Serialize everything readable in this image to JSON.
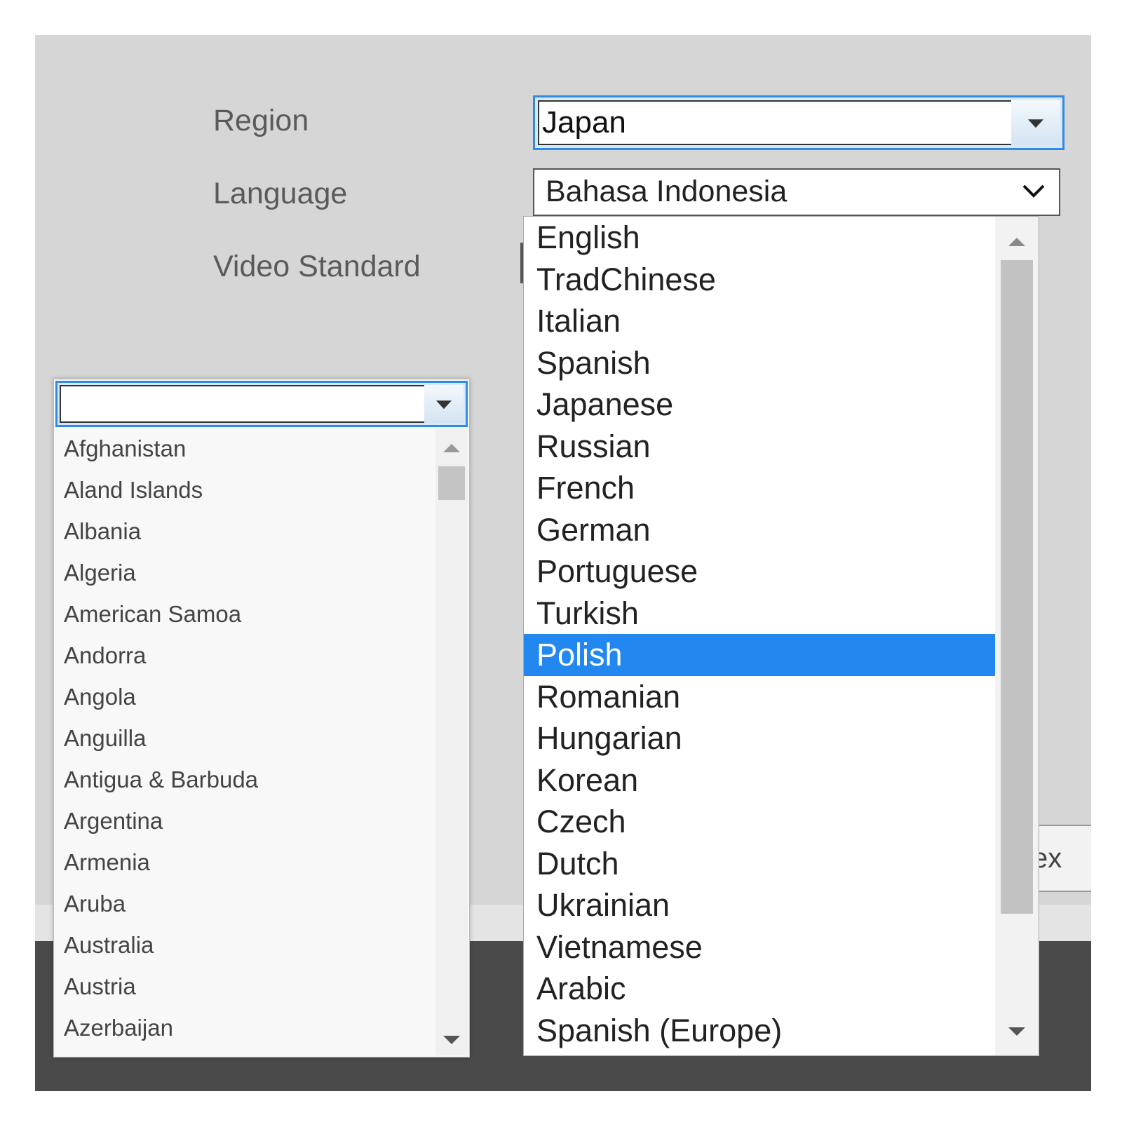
{
  "form": {
    "region_label": "Region",
    "language_label": "Language",
    "video_standard_label": "Video Standard"
  },
  "region": {
    "value": "Japan"
  },
  "language": {
    "selected_value": "Bahasa Indonesia",
    "options": [
      "English",
      "TradChinese",
      "Italian",
      "Spanish",
      "Japanese",
      "Russian",
      "French",
      "German",
      "Portuguese",
      "Turkish",
      "Polish",
      "Romanian",
      "Hungarian",
      "Korean",
      "Czech",
      "Dutch",
      "Ukrainian",
      "Vietnamese",
      "Arabic",
      "Spanish (Europe)"
    ],
    "highlighted": "Polish"
  },
  "country": {
    "value": "",
    "options": [
      "Afghanistan",
      "Aland Islands",
      "Albania",
      "Algeria",
      "American Samoa",
      "Andorra",
      "Angola",
      "Anguilla",
      "Antigua & Barbuda",
      "Argentina",
      "Armenia",
      "Aruba",
      "Australia",
      "Austria",
      "Azerbaijan"
    ]
  },
  "partial_button": {
    "label": "ex"
  },
  "colors": {
    "accent": "#2288f0",
    "panel": "#d6d6d6",
    "focus_border": "#2f8be6"
  }
}
